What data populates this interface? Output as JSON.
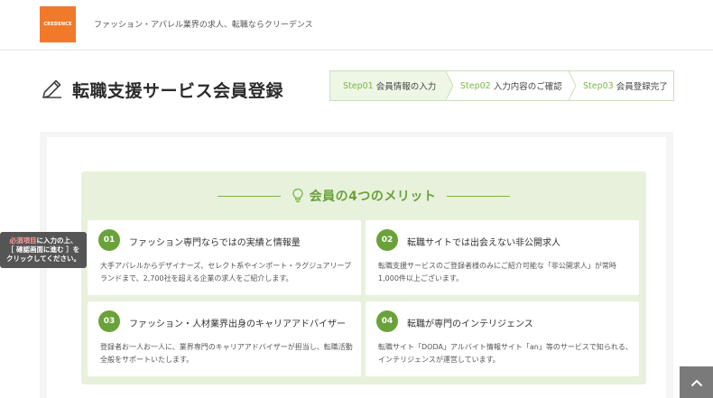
{
  "header": {
    "logo_text": "CREDENCE",
    "tagline": "ファッション・アパレル業界の求人、転職ならクリーデンス"
  },
  "page": {
    "title": "転職支援サービス会員登録"
  },
  "steps": [
    {
      "num": "Step01",
      "label": "会員情報の入力"
    },
    {
      "num": "Step02",
      "label": "入力内容のご確認"
    },
    {
      "num": "Step03",
      "label": "会員登録完了"
    }
  ],
  "merits": {
    "title": "会員の4つのメリット",
    "cards": [
      {
        "num": "01",
        "title": "ファッション専門ならではの実績と情報量",
        "text": "大手アパレルからデザイナーズ、セレクト系やインポート・ラグジュアリーブランドまで、2,700社を超える企業の求人をご紹介します。"
      },
      {
        "num": "02",
        "title": "転職サイトでは出会えない非公開求人",
        "text": "転職支援サービスのご登録者様のみにご紹介可能な「非公開求人」が常時1,000件以上ございます。"
      },
      {
        "num": "03",
        "title": "ファッション・人材業界出身のキャリアアドバイザー",
        "text": "登録者お一人お一人に、業界専門のキャリアアドバイザーが担当し、転職活動全般をサポートいたします。"
      },
      {
        "num": "04",
        "title": "転職が専門のインテリジェンス",
        "text": "転職サイト「DODA」アルバイト情報サイト「an」等のサービスで知られる、インテリジェンスが運営しています。"
      }
    ]
  },
  "side_tip": {
    "required": "必須項目",
    "line1_rest": "に入力の上、",
    "line2": "［ 確認画面に進む ］を",
    "line3": "クリックしてください。"
  },
  "colors": {
    "accent": "#6aa23a",
    "logo": "#f07a2a",
    "merit_bg": "#e7f1dc"
  },
  "icons": {
    "title": "pencil-icon",
    "merits": "lightbulb-icon",
    "scroll": "chevron-up-icon"
  }
}
